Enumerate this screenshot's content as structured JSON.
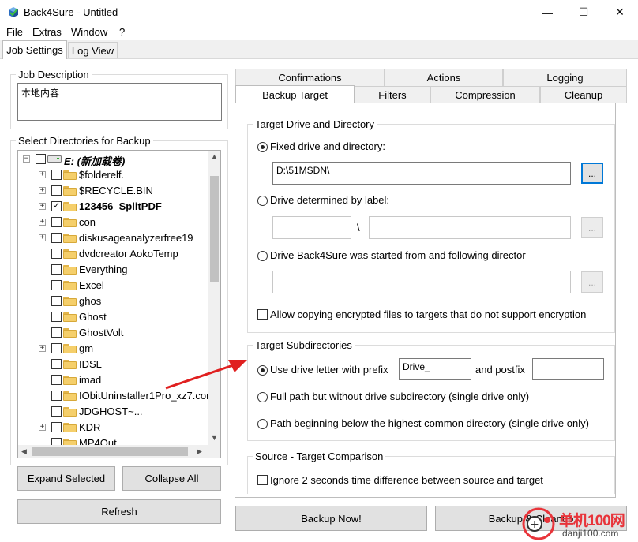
{
  "window": {
    "title": "Back4Sure - Untitled",
    "minimize": "—",
    "maximize": "☐",
    "close": "✕"
  },
  "menu": [
    "File",
    "Extras",
    "Window",
    "?"
  ],
  "main_tabs": {
    "job_settings": "Job Settings",
    "log_view": "Log View"
  },
  "job_description": {
    "label": "Job Description",
    "value": "本地内容"
  },
  "directories": {
    "label": "Select Directories for Backup",
    "root": "E: (新加载卷)",
    "items": [
      {
        "name": "$folderelf.",
        "expand": true,
        "checked": false,
        "bold": false
      },
      {
        "name": "$RECYCLE.BIN",
        "expand": true,
        "checked": false,
        "bold": false
      },
      {
        "name": "123456_SplitPDF",
        "expand": true,
        "checked": true,
        "bold": true
      },
      {
        "name": "con",
        "expand": true,
        "checked": false,
        "bold": false
      },
      {
        "name": "diskusageanalyzerfree19",
        "expand": true,
        "checked": false,
        "bold": false
      },
      {
        "name": "dvdcreator AokoTemp",
        "expand": false,
        "checked": false,
        "bold": false
      },
      {
        "name": "Everything",
        "expand": false,
        "checked": false,
        "bold": false
      },
      {
        "name": "Excel",
        "expand": false,
        "checked": false,
        "bold": false
      },
      {
        "name": "ghos",
        "expand": false,
        "checked": false,
        "bold": false
      },
      {
        "name": "Ghost",
        "expand": false,
        "checked": false,
        "bold": false
      },
      {
        "name": "GhostVolt",
        "expand": false,
        "checked": false,
        "bold": false
      },
      {
        "name": "gm",
        "expand": true,
        "checked": false,
        "bold": false
      },
      {
        "name": "IDSL",
        "expand": false,
        "checked": false,
        "bold": false
      },
      {
        "name": "imad",
        "expand": false,
        "checked": false,
        "bold": false
      },
      {
        "name": "IObitUninstaller1Pro_xz7.con",
        "expand": false,
        "checked": false,
        "bold": false
      },
      {
        "name": "JDGHOST~...",
        "expand": false,
        "checked": false,
        "bold": false
      },
      {
        "name": "KDR",
        "expand": true,
        "checked": false,
        "bold": false
      },
      {
        "name": "MP4Out",
        "expand": false,
        "checked": false,
        "bold": false
      }
    ]
  },
  "buttons": {
    "expand_selected": "Expand Selected",
    "collapse_all": "Collapse All",
    "refresh": "Refresh",
    "backup_now": "Backup Now!",
    "backup_cleanup": "Backup & Cleanup"
  },
  "right_tabs": {
    "row1": [
      "Confirmations",
      "Actions",
      "Logging"
    ],
    "row2": [
      "Backup Target",
      "Filters",
      "Compression",
      "Cleanup"
    ]
  },
  "target_drive": {
    "label": "Target Drive and Directory",
    "fixed_label": "Fixed drive and directory:",
    "fixed_value": "D:\\51MSDN\\",
    "by_label": "Drive determined by label:",
    "separator": "\\",
    "started_from": "Drive Back4Sure was started from and following director",
    "allow_encrypted": "Allow copying encrypted files to targets that do not support encryption",
    "browse": "..."
  },
  "target_subdirs": {
    "label": "Target Subdirectories",
    "use_letter": "Use drive letter with prefix",
    "prefix_value": "Drive_",
    "and_postfix": "and postfix",
    "postfix_value": "",
    "full_path": "Full path but without drive subdirectory (single drive only)",
    "below_common": "Path beginning below the highest common directory (single drive only)"
  },
  "comparison": {
    "label": "Source - Target Comparison",
    "ignore_2s": "Ignore 2 seconds time difference between source and target"
  },
  "watermark": {
    "text": "单机100网",
    "url": "danji100.com"
  },
  "colors": {
    "accent": "#0078d7",
    "arrow": "#e02020",
    "watermark": "#e8343a"
  }
}
